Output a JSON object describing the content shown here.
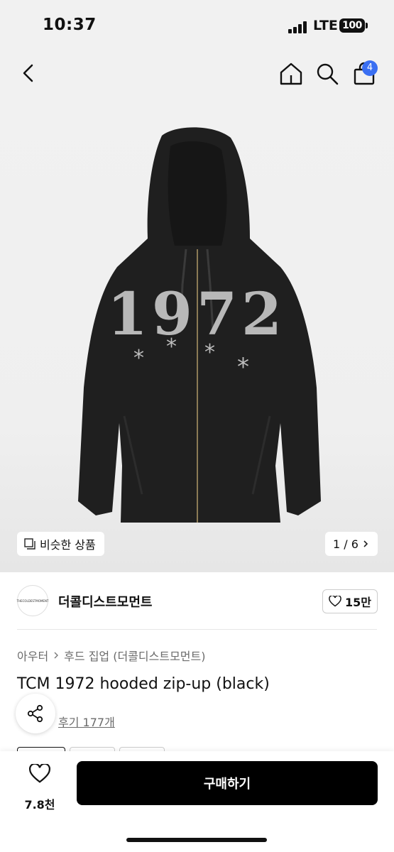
{
  "status_bar": {
    "time": "10:37",
    "network": "LTE",
    "battery": "100"
  },
  "nav": {
    "cart_count": "4",
    "icons": [
      "chevron-left-icon",
      "home-icon",
      "search-icon",
      "shopping-bag-icon"
    ]
  },
  "image": {
    "hoodie_print": "1972",
    "similar_label": "비슷한 상품",
    "page_indicator": "1 / 6"
  },
  "brand": {
    "name": "더콜디스트모먼트",
    "logo_text": "THECOLDESTMOMENT",
    "likes": "15만"
  },
  "breadcrumb": {
    "level1": "아우터",
    "level2": "후드 집업 (더콜디스트모먼트)"
  },
  "product": {
    "title": "TCM 1972 hooded zip-up (black)",
    "reviews": "후기 177개"
  },
  "bottom_bar": {
    "wish_count": "7.8천",
    "buy_label": "구매하기"
  },
  "colors": {
    "accent_badge": "#3a6ff2",
    "buy_button": "#000000"
  }
}
